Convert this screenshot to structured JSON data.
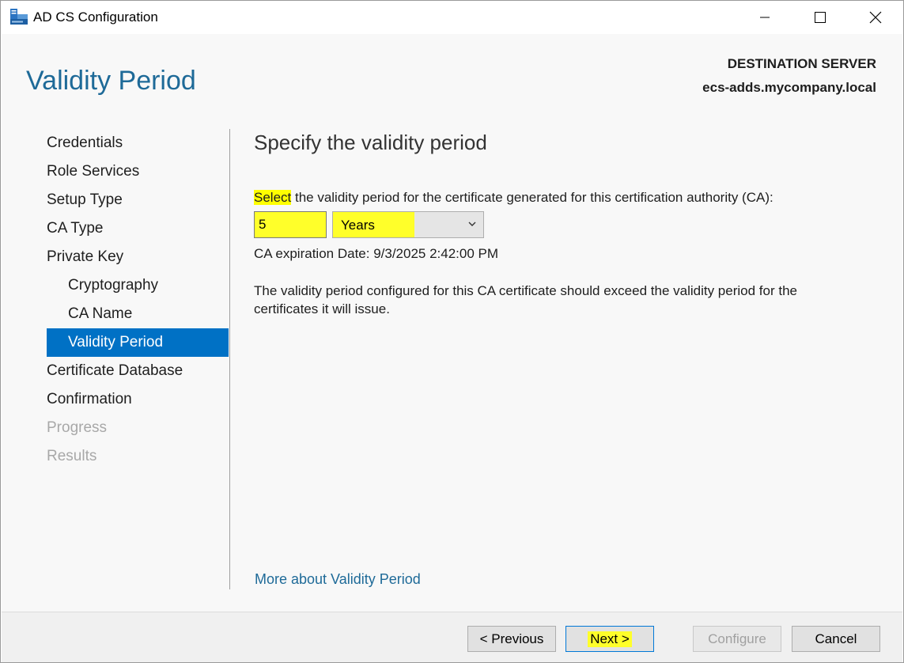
{
  "window": {
    "title": "AD CS Configuration",
    "controls": [
      "minimize-icon",
      "maximize-icon",
      "close-icon"
    ]
  },
  "header": {
    "page_title": "Validity Period",
    "destination_label": "DESTINATION SERVER",
    "destination_server": "ecs-adds.mycompany.local"
  },
  "nav": {
    "items": [
      {
        "label": "Credentials",
        "state": "normal",
        "indent": 0
      },
      {
        "label": "Role Services",
        "state": "normal",
        "indent": 0
      },
      {
        "label": "Setup Type",
        "state": "normal",
        "indent": 0
      },
      {
        "label": "CA Type",
        "state": "normal",
        "indent": 0
      },
      {
        "label": "Private Key",
        "state": "normal",
        "indent": 0
      },
      {
        "label": "Cryptography",
        "state": "normal",
        "indent": 1
      },
      {
        "label": "CA Name",
        "state": "normal",
        "indent": 1
      },
      {
        "label": "Validity Period",
        "state": "selected",
        "indent": 1
      },
      {
        "label": "Certificate Database",
        "state": "normal",
        "indent": 0
      },
      {
        "label": "Confirmation",
        "state": "normal",
        "indent": 0
      },
      {
        "label": "Progress",
        "state": "disabled",
        "indent": 0
      },
      {
        "label": "Results",
        "state": "disabled",
        "indent": 0
      }
    ]
  },
  "main": {
    "section_title": "Specify the validity period",
    "instruction_highlight": "Select",
    "instruction_rest": " the validity period for the certificate generated for this certification authority (CA):",
    "period_value": "5",
    "unit_selected": "Years",
    "expiration": "CA expiration Date: 9/3/2025 2:42:00 PM",
    "note": "The validity period configured for this CA certificate should exceed the validity period for the certificates it will issue.",
    "more_link": "More about Validity Period"
  },
  "footer": {
    "previous_label": "< Previous",
    "next_label": "Next >",
    "configure_label": "Configure",
    "cancel_label": "Cancel"
  },
  "colors": {
    "accent": "#0071c5",
    "heading": "#1e6a98",
    "highlight": "#ffff00"
  }
}
